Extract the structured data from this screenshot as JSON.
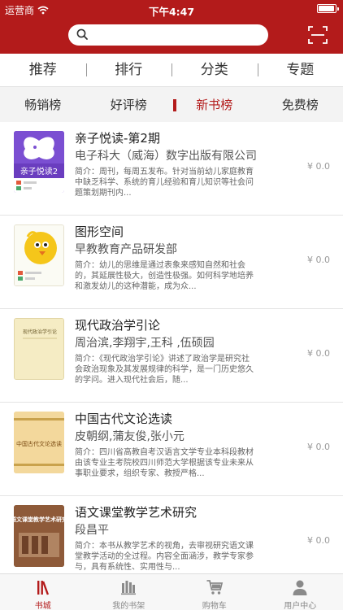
{
  "status_bar": {
    "carrier": "运营商",
    "time": "下午4:47",
    "battery_level": 0.95
  },
  "header": {
    "search_value": "",
    "search_icon": "search-icon",
    "scan_icon": "scan-icon",
    "brand_color": "#b31b1b"
  },
  "primary_tabs": [
    {
      "label": "推荐"
    },
    {
      "label": "排行"
    },
    {
      "label": "分类"
    },
    {
      "label": "专题"
    }
  ],
  "sub_tabs": [
    {
      "label": "畅销榜",
      "active": false
    },
    {
      "label": "好评榜",
      "active": false
    },
    {
      "label": "新书榜",
      "active": true
    },
    {
      "label": "免费榜",
      "active": false
    }
  ],
  "books": [
    {
      "title": "亲子悦读-第2期",
      "author": "电子科大（威海）数字出版有限公司",
      "description": "简介：周刊，每周五发布。针对当前幼儿家庭教育中缺乏科学、系统的育儿经验和育儿知识等社会问题策划期刊内...",
      "price": "¥ 0.0",
      "cover_text": "亲子悦读2"
    },
    {
      "title": "图形空间",
      "author": "早教教育产品研发部",
      "description": "简介：幼儿的思维是通过表象来感知自然和社会的，其延展性极大，创造性极强。如何科学地培养和激发幼儿的这种潜能，成为众...",
      "price": "¥ 0.0",
      "cover_text": ""
    },
    {
      "title": "现代政治学引论",
      "author": "周治滨,李翔宇,王科 ,伍硕园",
      "description": "简介：《现代政治学引论》讲述了政治学是研究社会政治现象及其发展规律的科学，是一门历史悠久的学问。进入现代社会后，随...",
      "price": "¥ 0.0",
      "cover_text": "现代政治学引论"
    },
    {
      "title": "中国古代文论选读",
      "author": "皮朝纲,蒲友俊,张小元",
      "description": "简介：四川省高教自考汉语言文学专业本科段教材由该专业主考院校四川师范大学根据该专业未来从事职业要求，组织专家、教授严格...",
      "price": "¥ 0.0",
      "cover_text": "中国古代文论选读"
    },
    {
      "title": "语文课堂教学艺术研究",
      "author": "段昌平",
      "description": "简介：本书从教学艺术的视角，去审视研究语文课堂教学活动的全过程。内容全面涵涉，教学专家参与，具有系统性、实用性与...",
      "price": "¥ 0.0",
      "cover_text": "语文课堂教学艺术研究"
    }
  ],
  "tabbar": [
    {
      "label": "书城",
      "icon": "bookstore-icon",
      "active": true
    },
    {
      "label": "我的书架",
      "icon": "bookshelf-icon",
      "active": false
    },
    {
      "label": "购物车",
      "icon": "cart-icon",
      "active": false
    },
    {
      "label": "用户中心",
      "icon": "user-icon",
      "active": false
    }
  ]
}
